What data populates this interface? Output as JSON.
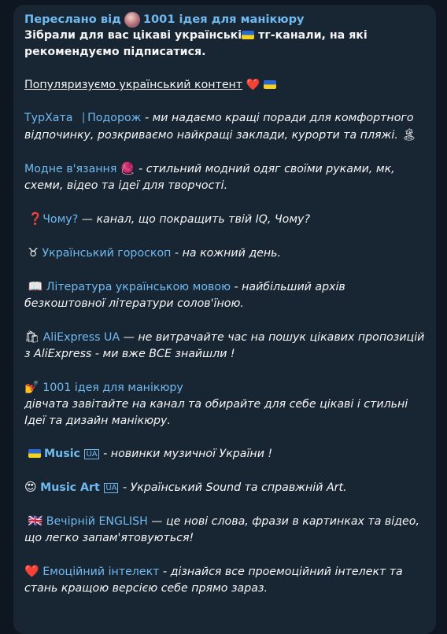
{
  "forwarded": {
    "prefix": "Переслано від",
    "channel": "1001 ідея для манікюру"
  },
  "intro": {
    "line": "Зібрали для вас цікаві українські",
    "line_rest": " тг-канали, на які рекомендуємо підписатися."
  },
  "promo": "Популяризуємо український контент",
  "items": [
    {
      "emoji": "",
      "name": "ТурХата⎹ Подорож",
      "desc": " - ми надаємо кращі поради для комфортного відпочинку, розкриваємо найкращі заклади, курорти та пляжі.",
      "trail": "🏝"
    },
    {
      "emoji": "",
      "name": " Модне в'язання",
      "mid": "🧶",
      "desc": " - стильний модний одяг своїми руками, мк, схеми, відео та ідеї для творчості.",
      "trail": ""
    },
    {
      "emoji": "❓",
      "name": "Чому?",
      "desc": " — канал, що покращить твій IQ, Чому?",
      "trail": ""
    },
    {
      "emoji": "♉",
      "name": "Український гороскоп",
      "desc": " - на кожний день.",
      "trail": ""
    },
    {
      "emoji": "📖",
      "name": "Література українською мовою",
      "desc": " - найбільший архів безкоштовної літератури солов'їною.",
      "trail": ""
    },
    {
      "emoji": "🛍",
      "name": "AliExpress UA",
      "desc": " — не витрачайте час на пошук цікавих пропозицій з AliExpress - ми вже ВСЕ знайшли !",
      "trail": ""
    },
    {
      "emoji": "💅",
      "name": "1001 ідея для манікюру",
      "desc": "дівчата завітайте на канал та обирайте для себе цікаві і стильні Ідеї та дизайн манікюру.",
      "trail": ""
    },
    {
      "emoji": "flag",
      "name": "Music",
      "ua": "UA",
      "desc": " - новинки музичної України !",
      "trail": ""
    },
    {
      "emoji": "😍",
      "name": "Music Art",
      "ua": "UA",
      "desc": " - Український Sound та справжній Art.",
      "trail": ""
    },
    {
      "emoji": "🇬🇧",
      "name": "Вечірній ENGLISH",
      "desc": " — це нові слова, фрази в картинках та відео, що легко запам'ятовуються!",
      "trail": ""
    },
    {
      "emoji": "❤️",
      "name": "Емоційний інтелект",
      "desc": " - дізнайся все проемоційний інтелект та стань кращою версією себе прямо зараз.",
      "trail": ""
    }
  ]
}
